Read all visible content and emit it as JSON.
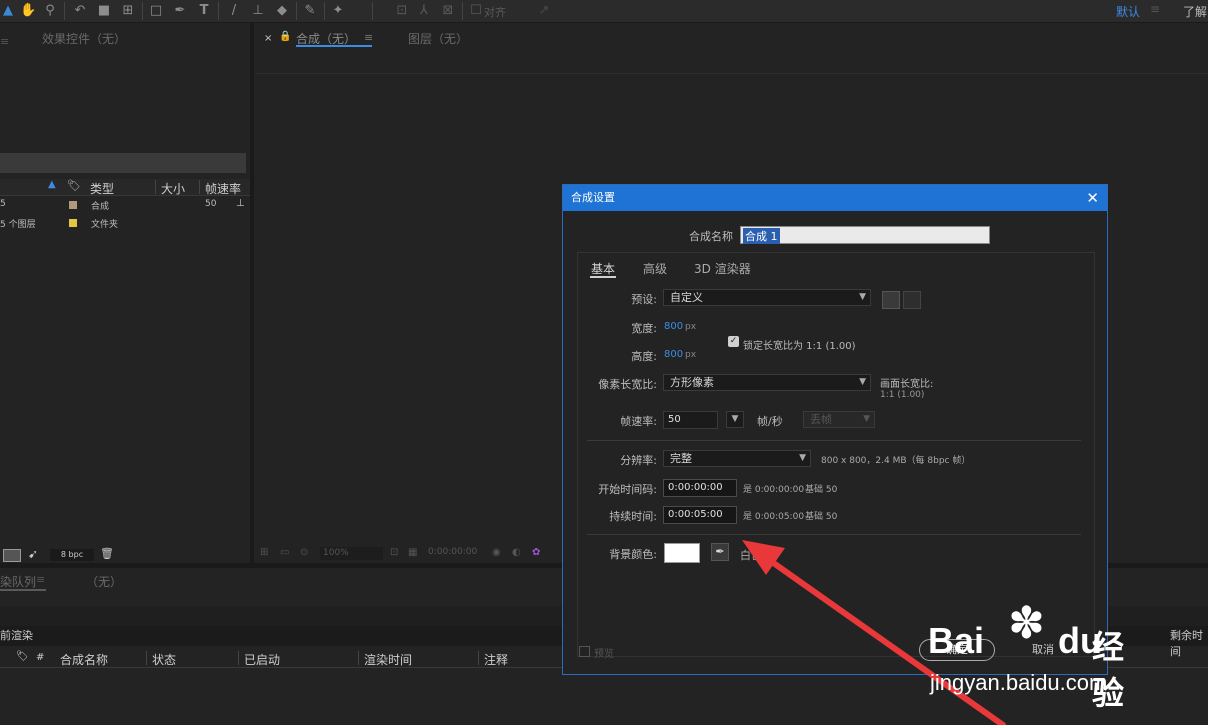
{
  "toolbar": {
    "align_label": "对齐",
    "workspace_default": "默认",
    "workspace_learn": "了解"
  },
  "effects_panel": {
    "tab_label": "效果控件（无）"
  },
  "comp_viewer": {
    "tab_label": "合成（无）",
    "layer_tab_label": "图层（无）",
    "zoom": "100%",
    "timecode": "0:00:00:00"
  },
  "project_panel": {
    "columns": {
      "type": "类型",
      "size": "大小",
      "fps": "帧速率"
    },
    "rows": [
      {
        "name": "5",
        "type": "合成",
        "fps": "50",
        "swatch": "#b09a7c"
      },
      {
        "name": "5 个图层",
        "type": "文件夹",
        "fps": "",
        "swatch": "#e3c844"
      }
    ],
    "bpc": "8 bpc"
  },
  "render_queue": {
    "tab_label": "染队列",
    "tab2_label": "（无）",
    "current_render": "前渲染",
    "remaining_label": "剩余时间",
    "columns": {
      "hash": "#",
      "comp_name": "合成名称",
      "status": "状态",
      "started": "已启动",
      "render_time": "渲染时间",
      "comment": "注释"
    }
  },
  "dialog": {
    "title": "合成设置",
    "comp_name_label": "合成名称",
    "comp_name_value": "合成 1",
    "tabs": [
      "基本",
      "高级",
      "3D 渲染器"
    ],
    "preset_label": "预设:",
    "preset_value": "自定义",
    "width_label": "宽度:",
    "width_value": "800",
    "height_label": "高度:",
    "height_value": "800",
    "px_unit": "px",
    "lock_aspect_label": "锁定长宽比为 1:1 (1.00)",
    "pixel_aspect_label": "像素长宽比:",
    "pixel_aspect_value": "方形像素",
    "frame_aspect_label": "画面长宽比:",
    "frame_aspect_value": "1:1 (1.00)",
    "fps_label": "帧速率:",
    "fps_value": "50",
    "fps_unit": "帧/秒",
    "drop_frame": "丢帧",
    "resolution_label": "分辨率:",
    "resolution_value": "完整",
    "resolution_info": "800 x 800，2.4 MB（每 8bpc 帧）",
    "start_tc_label": "开始时间码:",
    "start_tc_value": "0:00:00:00",
    "start_tc_info": "是 0:00:00:00",
    "base_label": "基础 50",
    "duration_label": "持续时间:",
    "duration_value": "0:00:05:00",
    "duration_info": "是 0:00:05:00",
    "bg_color_label": "背景颜色:",
    "bg_color_name": "白色",
    "bg_color": "#ffffff",
    "preview_label": "预览",
    "ok_label": "确定",
    "cancel_label": "取消"
  },
  "watermark": {
    "brand_b": "Bai",
    "brand_du": "du",
    "brand_cn": "经验",
    "url": "jingyan.baidu.com"
  },
  "annotation_arrow_color": "#e8383a"
}
